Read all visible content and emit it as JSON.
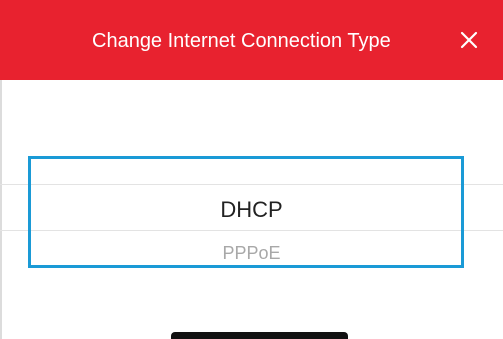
{
  "header": {
    "title": "Change Internet Connection Type",
    "close_icon": "close-icon",
    "background_color": "#e8222f"
  },
  "picker": {
    "options": [
      {
        "label": "DHCP",
        "state": "selected"
      },
      {
        "label": "PPPoE",
        "state": "unselected"
      }
    ],
    "highlight_color": "#1a9ad6"
  }
}
